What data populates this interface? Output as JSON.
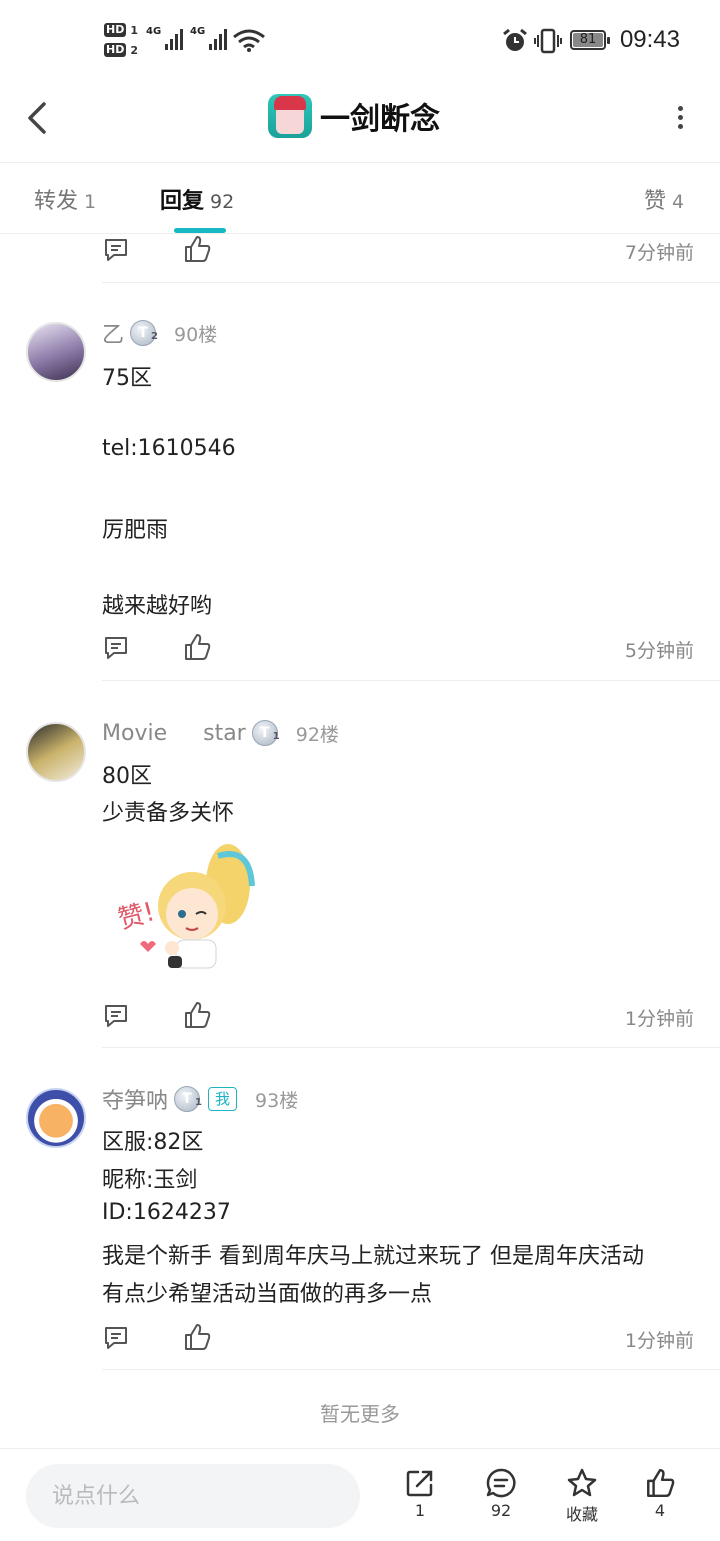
{
  "status_bar": {
    "hd1": "HD",
    "sim1": "1",
    "hd2": "HD",
    "sim2": "2",
    "net1": "4G",
    "net2": "4G",
    "battery": "81",
    "time": "09:43"
  },
  "header": {
    "title": "一剑断念"
  },
  "tabs": [
    {
      "label": "转发",
      "count": "1"
    },
    {
      "label": "回复",
      "count": "92"
    },
    {
      "label": "赞",
      "count": "4"
    }
  ],
  "comments": [
    {
      "time": "7分钟前"
    },
    {
      "username": "乙",
      "level": "T",
      "level_num": "2",
      "floor": "90楼",
      "lines": [
        "75区",
        "tel:1610546",
        "厉肥雨",
        "越来越好哟"
      ],
      "time": "5分钟前"
    },
    {
      "username_part1": "Movie",
      "username_part2": "star",
      "level": "T",
      "level_num": "1",
      "floor": "92楼",
      "lines": [
        "80区",
        "少责备多关怀"
      ],
      "sticker_text": "赞!",
      "time": "1分钟前"
    },
    {
      "username": "夺笋呐",
      "level": "T",
      "level_num": "1",
      "me_tag": "我",
      "floor": "93楼",
      "lines": [
        "区服:82区",
        "昵称:玉剑",
        "ID:1624237",
        "我是个新手 看到周年庆马上就过来玩了 但是周年庆活动",
        "有点少希望活动当面做的再多一点"
      ],
      "time": "1分钟前"
    }
  ],
  "no_more": "暂无更多",
  "bottom_bar": {
    "input_placeholder": "说点什么",
    "share_count": "1",
    "comment_count": "92",
    "favorite_label": "收藏",
    "like_count": "4"
  },
  "colors": {
    "accent": "#17b7c3",
    "text": "#222222",
    "muted": "#888888"
  }
}
